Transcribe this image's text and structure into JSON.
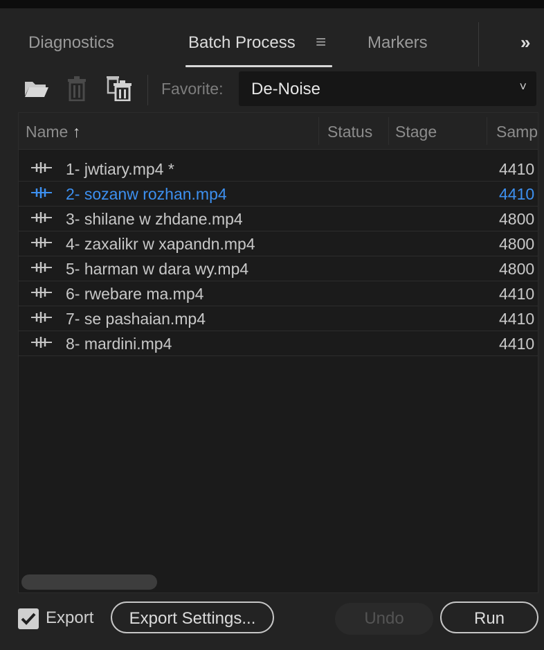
{
  "tabs": [
    {
      "label": "Diagnostics"
    },
    {
      "label": "Batch Process"
    },
    {
      "label": "Markers"
    }
  ],
  "tab_menu_glyph": "≡",
  "overflow_glyph": "»",
  "toolbar": {
    "favorite_label": "Favorite:",
    "favorite_value": "De-Noise",
    "caret": "˅"
  },
  "columns": {
    "name": "Name",
    "name_sort": "↑",
    "status": "Status",
    "stage": "Stage",
    "sample": "Samp"
  },
  "rows": [
    {
      "name": "1- jwtiary.mp4 *",
      "rate": "4410"
    },
    {
      "name": "2- sozanw rozhan.mp4",
      "rate": "4410",
      "selected": true
    },
    {
      "name": "3- shilane w zhdane.mp4",
      "rate": "4800"
    },
    {
      "name": "4- zaxalikr w xapandn.mp4",
      "rate": "4800"
    },
    {
      "name": "5- harman w dara wy.mp4",
      "rate": "4800"
    },
    {
      "name": "6- rwebare ma.mp4",
      "rate": "4410"
    },
    {
      "name": "7- se pashaian.mp4",
      "rate": "4410"
    },
    {
      "name": "8- mardini.mp4",
      "rate": "4410"
    }
  ],
  "footer": {
    "export_label": "Export",
    "export_checked": true,
    "export_settings_label": "Export Settings...",
    "undo_label": "Undo",
    "run_label": "Run"
  },
  "colors": {
    "selection": "#3d90f0",
    "panel_bg": "#232323",
    "list_bg": "#1b1b1b"
  },
  "icons": [
    "open-folder-icon",
    "trash-icon",
    "trash-all-icon",
    "waveform-icon",
    "chevron-down-icon",
    "double-chevron-icon",
    "hamburger-menu-icon",
    "checkmark-icon"
  ]
}
